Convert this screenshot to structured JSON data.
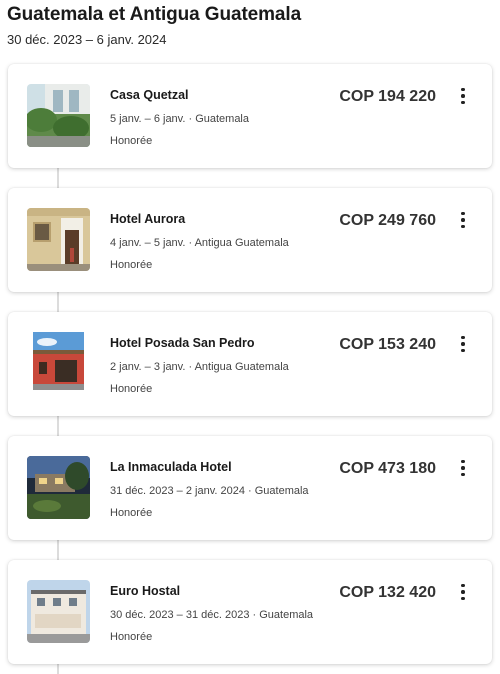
{
  "trip": {
    "title": "Guatemala et Antigua Guatemala",
    "dates": "30 déc. 2023 – 6 janv. 2024"
  },
  "bookings": [
    {
      "name": "Casa Quetzal",
      "price": "COP 194 220",
      "dates": "5 janv. – 6 janv.",
      "location": "Guatemala",
      "meta": "5 janv. – 6 janv. · Guatemala",
      "status": "Honorée",
      "image": "hotel-photo-courtyard-palm"
    },
    {
      "name": "Hotel Aurora",
      "price": "COP 249 760",
      "dates": "4 janv. – 5 janv.",
      "location": "Antigua Guatemala",
      "meta": "4 janv. – 5 janv. · Antigua Guatemala",
      "status": "Honorée",
      "image": "hotel-photo-colonial-door"
    },
    {
      "name": "Hotel Posada San Pedro",
      "price": "COP 153 240",
      "dates": "2 janv. – 3 janv.",
      "location": "Antigua Guatemala",
      "meta": "2 janv. – 3 janv. · Antigua Guatemala",
      "status": "Honorée",
      "image": "hotel-photo-red-facade"
    },
    {
      "name": "La Inmaculada Hotel",
      "price": "COP 473 180",
      "dates": "31 déc. 2023 – 2 janv. 2024",
      "location": "Guatemala",
      "meta": "31 déc. 2023 – 2 janv. 2024 · Guatemala",
      "status": "Honorée",
      "image": "hotel-photo-night-garden"
    },
    {
      "name": "Euro Hostal",
      "price": "COP 132 420",
      "dates": "30 déc. 2023 – 31 déc. 2023",
      "location": "Guatemala",
      "meta": "30 déc. 2023 – 31 déc. 2023 · Guatemala",
      "status": "Honorée",
      "image": "hotel-photo-white-building"
    }
  ],
  "colors": {
    "text": "#1a1a1a",
    "secondary": "#444444",
    "timeline": "#dcdcdc"
  },
  "icons": {
    "more": "more-vertical-icon"
  }
}
